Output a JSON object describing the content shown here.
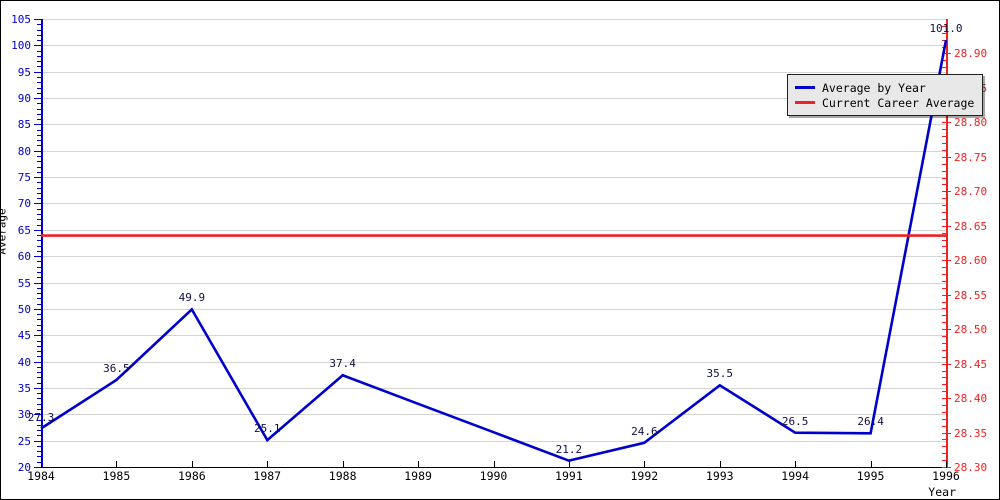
{
  "chart_data": {
    "type": "line",
    "title": "",
    "xlabel": "Year",
    "ylabel": "Average",
    "y2label": "",
    "grid": true,
    "legend_position": "top-right",
    "categories": [
      "1984",
      "1985",
      "1986",
      "1987",
      "1988",
      "1989",
      "1990",
      "1991",
      "1992",
      "1993",
      "1994",
      "1995",
      "1996"
    ],
    "x": [
      1984,
      1985,
      1986,
      1987,
      1988,
      1989,
      1990,
      1991,
      1992,
      1993,
      1994,
      1995,
      1996
    ],
    "xlim": [
      1984,
      1996
    ],
    "ylim": [
      20,
      105
    ],
    "y2lim": [
      28.3,
      28.95
    ],
    "series": [
      {
        "name": "Average by Year",
        "color": "#0000cc",
        "axis": "left",
        "values": [
          27.3,
          36.5,
          49.9,
          25.1,
          37.4,
          32.0,
          26.6,
          21.2,
          24.6,
          35.5,
          26.5,
          26.4,
          101.0
        ],
        "point_labels": [
          "27.3",
          "36.5",
          "49.9",
          "25.1",
          "37.4",
          "",
          "",
          "21.2",
          "24.6",
          "35.5",
          "26.5",
          "26.4",
          "101.0"
        ]
      },
      {
        "name": "Current Career Average",
        "color": "#ee2222",
        "axis": "left",
        "constant_value": 63.9,
        "values": [
          63.9,
          63.9,
          63.9,
          63.9,
          63.9,
          63.9,
          63.9,
          63.9,
          63.9,
          63.9,
          63.9,
          63.9,
          63.9
        ],
        "point_labels": [
          "",
          "",
          "",
          "",
          "",
          "",
          "",
          "",
          "",
          "",
          "",
          "",
          ""
        ]
      }
    ],
    "left_axis": {
      "color": "#0000cc",
      "major_ticks": [
        20,
        25,
        30,
        35,
        40,
        45,
        50,
        55,
        60,
        65,
        70,
        75,
        80,
        85,
        90,
        95,
        100,
        105
      ],
      "tick_labels": [
        "20",
        "25",
        "30",
        "35",
        "40",
        "45",
        "50",
        "55",
        "60",
        "65",
        "70",
        "75",
        "80",
        "85",
        "90",
        "95",
        "100",
        "105"
      ],
      "minor_step": 1
    },
    "right_axis": {
      "color": "#ee2222",
      "major_ticks": [
        28.3,
        28.35,
        28.4,
        28.45,
        28.5,
        28.55,
        28.6,
        28.65,
        28.7,
        28.75,
        28.8,
        28.85,
        28.9
      ],
      "tick_labels": [
        "28.30",
        "28.35",
        "28.40",
        "28.45",
        "28.50",
        "28.55",
        "28.60",
        "28.65",
        "28.70",
        "28.75",
        "28.80",
        "28.85",
        "28.90"
      ],
      "minor_step": 0.01
    },
    "gridline_values": [
      25,
      30,
      35,
      40,
      45,
      50,
      55,
      60,
      65,
      70,
      75,
      80,
      85,
      90,
      95,
      100,
      105
    ]
  },
  "legend": {
    "items": [
      {
        "label": "Average by Year",
        "color": "#0000cc"
      },
      {
        "label": "Current Career Average",
        "color": "#ee2222"
      }
    ]
  },
  "colors": {
    "series_primary": "#0000cc",
    "series_secondary": "#ee2222",
    "grid": "#d4d4d4",
    "background": "#ffffff",
    "border": "#000000"
  }
}
